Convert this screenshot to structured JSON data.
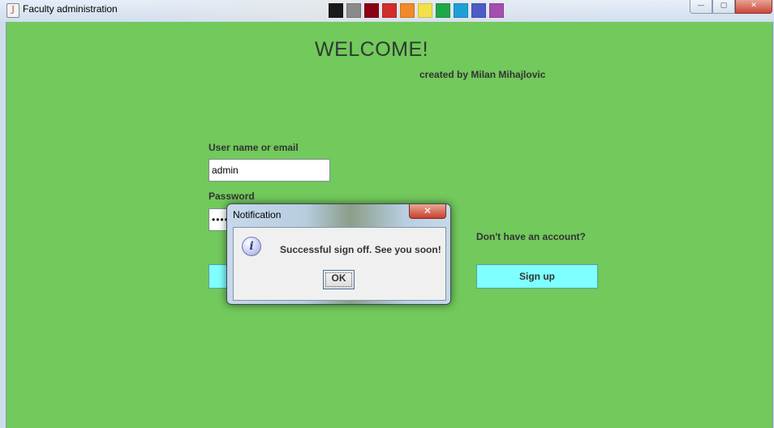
{
  "window": {
    "title": "Faculty administration",
    "controls": {
      "min": "—",
      "max": "▢",
      "close": "✕"
    },
    "app_icon": "java-icon"
  },
  "colors": {
    "background": "#72c95c",
    "button": "#7fffff",
    "palette": [
      "#1a1a1a",
      "#8a8a8a",
      "#8b0015",
      "#d12d2d",
      "#f08a2a",
      "#f2e14a",
      "#1fa84a",
      "#1ea0d6",
      "#4f5bc4",
      "#a64db0"
    ]
  },
  "main": {
    "heading": "WELCOME!",
    "credit": "created by Milan Mihajlovic",
    "username_label": "User name or email",
    "username_value": "admin",
    "password_label": "Password",
    "password_value": "•••••••••",
    "no_account_label": "Don't have an account?",
    "signup_button": "Sign up"
  },
  "dialog": {
    "title": "Notification",
    "close": "✕",
    "icon": "info-icon",
    "icon_glyph": "i",
    "message": "Successful sign off. See you soon!",
    "ok_button": "OK"
  }
}
